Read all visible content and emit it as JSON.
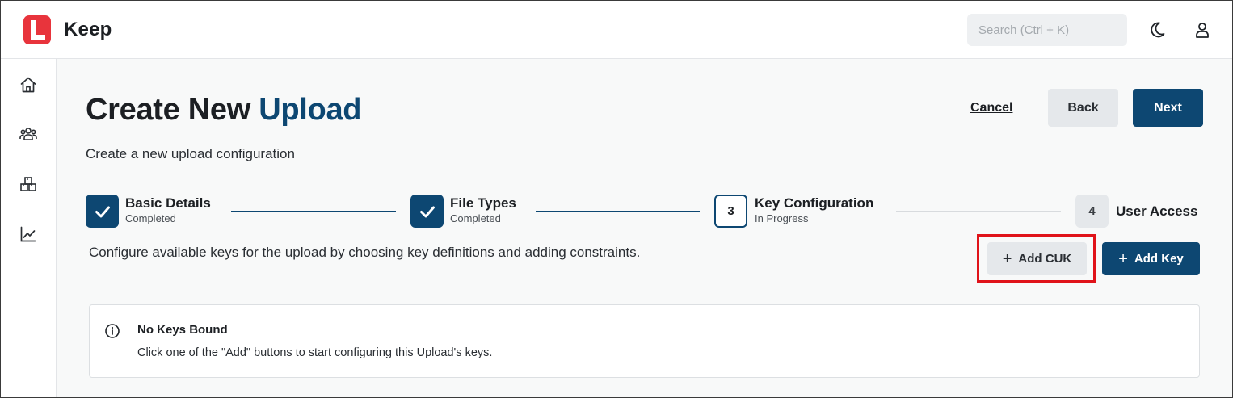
{
  "app": {
    "name": "Keep",
    "brand_color": "#e8343c",
    "accent_color": "#0d4772"
  },
  "header": {
    "search_placeholder": "Search (Ctrl + K)",
    "icons": [
      "moon-icon",
      "user-icon"
    ]
  },
  "sidebar": {
    "items": [
      {
        "icon": "home-icon"
      },
      {
        "icon": "users-icon"
      },
      {
        "icon": "boxes-icon"
      },
      {
        "icon": "chart-icon"
      }
    ]
  },
  "page": {
    "title_main": "Create New",
    "title_accent": "Upload",
    "subtitle": "Create a new upload configuration",
    "cancel_label": "Cancel",
    "back_label": "Back",
    "next_label": "Next"
  },
  "stepper": {
    "steps": [
      {
        "title": "Basic Details",
        "status": "Completed"
      },
      {
        "title": "File Types",
        "status": "Completed"
      },
      {
        "number": "3",
        "title": "Key Configuration",
        "status": "In Progress"
      },
      {
        "number": "4",
        "title": "User Access",
        "status": ""
      }
    ]
  },
  "keys": {
    "description": "Configure available keys for the upload by choosing key definitions and adding constraints.",
    "add_cuk_label": "Add CUK",
    "add_key_label": "Add Key",
    "empty": {
      "title": "No Keys Bound",
      "text": "Click one of the \"Add\" buttons to start configuring this Upload's keys."
    }
  }
}
